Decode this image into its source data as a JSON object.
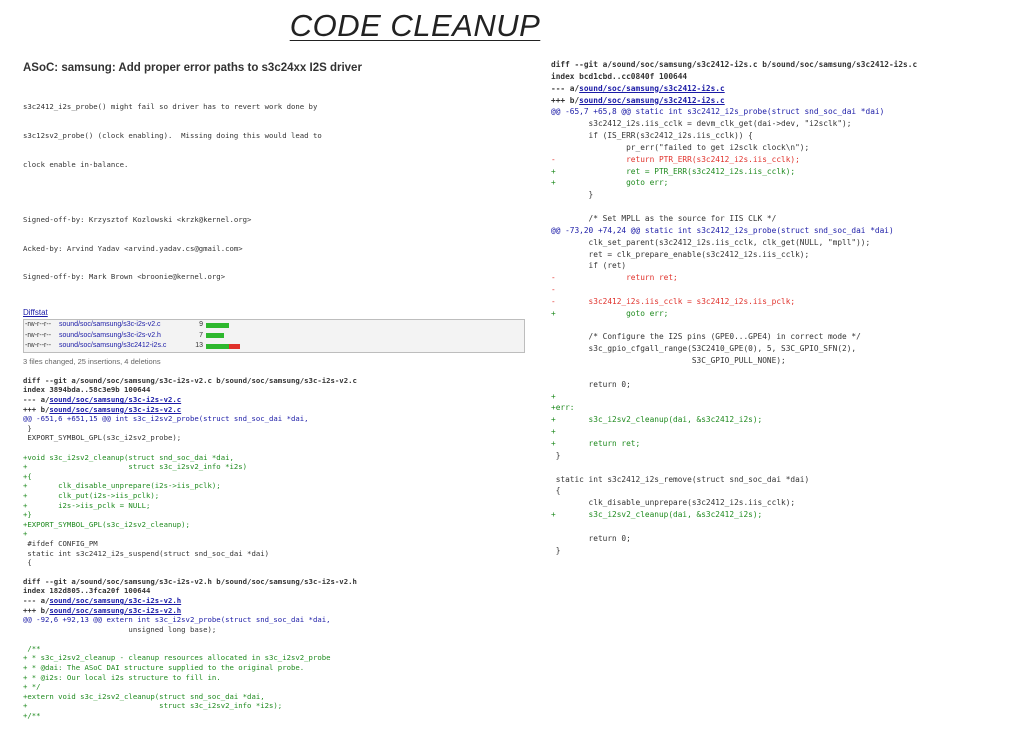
{
  "slide": {
    "title": "CODE CLEANUP"
  },
  "commit": {
    "title": "ASoC: samsung: Add proper error paths to s3c24xx I2S driver",
    "message": [
      "s3c2412_i2s_probe() might fail so driver has to revert work done by",
      "s3c12sv2_probe() (clock enabling).  Missing doing this would lead to",
      "clock enable in-balance."
    ],
    "signoffs": [
      "Signed-off-by: Krzysztof Kozlowski <krzk@kernel.org>",
      "Acked-by: Arvind Yadav <arvind.yadav.cs@gmail.com>",
      "Signed-off-by: Mark Brown <broonie@kernel.org>"
    ]
  },
  "diffstat": {
    "label": "Diffstat",
    "rows": [
      {
        "perm": "-rw-r--r--",
        "path": "sound/soc/samsung/s3c-i2s-v2.c",
        "count": "9",
        "added": 9,
        "removed": 0
      },
      {
        "perm": "-rw-r--r--",
        "path": "sound/soc/samsung/s3c-i2s-v2.h",
        "count": "7",
        "added": 7,
        "removed": 0
      },
      {
        "perm": "-rw-r--r--",
        "path": "sound/soc/samsung/s3c2412-i2s.c",
        "count": "13",
        "added": 9,
        "removed": 4
      }
    ],
    "summary": "3 files changed, 25 insertions, 4 deletions"
  },
  "left_diffs": [
    {
      "header": "diff --git a/sound/soc/samsung/s3c-i2s-v2.c b/sound/soc/samsung/s3c-i2s-v2.c",
      "index": "index 3894bda..58c3e9b 100644",
      "minus_prefix": "--- a/",
      "minus_path": "sound/soc/samsung/s3c-i2s-v2.c",
      "plus_prefix": "+++ b/",
      "plus_path": "sound/soc/samsung/s3c-i2s-v2.c",
      "lines": [
        {
          "t": "hunk",
          "text": "@@ -651,6 +651,15 @@ int s3c_i2sv2_probe(struct snd_soc_dai *dai,"
        },
        {
          "t": "ctx",
          "text": " }"
        },
        {
          "t": "ctx",
          "text": " EXPORT_SYMBOL_GPL(s3c_i2sv2_probe);"
        },
        {
          "t": "ctx",
          "text": " "
        },
        {
          "t": "add",
          "text": "+void s3c_i2sv2_cleanup(struct snd_soc_dai *dai,"
        },
        {
          "t": "add",
          "text": "+                       struct s3c_i2sv2_info *i2s)"
        },
        {
          "t": "add",
          "text": "+{"
        },
        {
          "t": "add",
          "text": "+       clk_disable_unprepare(i2s->iis_pclk);"
        },
        {
          "t": "add",
          "text": "+       clk_put(i2s->iis_pclk);"
        },
        {
          "t": "add",
          "text": "+       i2s->iis_pclk = NULL;"
        },
        {
          "t": "add",
          "text": "+}"
        },
        {
          "t": "add",
          "text": "+EXPORT_SYMBOL_GPL(s3c_i2sv2_cleanup);"
        },
        {
          "t": "add",
          "text": "+"
        },
        {
          "t": "ctx",
          "text": " #ifdef CONFIG_PM"
        },
        {
          "t": "ctx",
          "text": " static int s3c2412_i2s_suspend(struct snd_soc_dai *dai)"
        },
        {
          "t": "ctx",
          "text": " {"
        }
      ]
    },
    {
      "header": "diff --git a/sound/soc/samsung/s3c-i2s-v2.h b/sound/soc/samsung/s3c-i2s-v2.h",
      "index": "index 182d805..3fca20f 100644",
      "minus_prefix": "--- a/",
      "minus_path": "sound/soc/samsung/s3c-i2s-v2.h",
      "plus_prefix": "+++ b/",
      "plus_path": "sound/soc/samsung/s3c-i2s-v2.h",
      "lines": [
        {
          "t": "hunk",
          "text": "@@ -92,6 +92,13 @@ extern int s3c_i2sv2_probe(struct snd_soc_dai *dai,"
        },
        {
          "t": "ctx",
          "text": "                        unsigned long base);"
        },
        {
          "t": "ctx",
          "text": " "
        },
        {
          "t": "add",
          "text": " /**"
        },
        {
          "t": "add",
          "text": "+ * s3c_i2sv2_cleanup - cleanup resources allocated in s3c_i2sv2_probe"
        },
        {
          "t": "add",
          "text": "+ * @dai: The ASoC DAI structure supplied to the original probe."
        },
        {
          "t": "add",
          "text": "+ * @i2s: Our local i2s structure to fill in."
        },
        {
          "t": "add",
          "text": "+ */"
        },
        {
          "t": "add",
          "text": "+extern void s3c_i2sv2_cleanup(struct snd_soc_dai *dai,"
        },
        {
          "t": "add",
          "text": "+                              struct s3c_i2sv2_info *i2s);"
        },
        {
          "t": "add",
          "text": "+/**"
        }
      ]
    }
  ],
  "right_diff": {
    "header": "diff --git a/sound/soc/samsung/s3c2412-i2s.c b/sound/soc/samsung/s3c2412-i2s.c",
    "index": "index bcd1cbd..cc0840f 100644",
    "minus_prefix": "--- a/",
    "minus_path": "sound/soc/samsung/s3c2412-i2s.c",
    "plus_prefix": "+++ b/",
    "plus_path": "sound/soc/samsung/s3c2412-i2s.c",
    "lines": [
      {
        "t": "hunk",
        "text": "@@ -65,7 +65,8 @@ static int s3c2412_i2s_probe(struct snd_soc_dai *dai)"
      },
      {
        "t": "ctx",
        "text": "        s3c2412_i2s.iis_cclk = devm_clk_get(dai->dev, \"i2sclk\");"
      },
      {
        "t": "ctx",
        "text": "        if (IS_ERR(s3c2412_i2s.iis_cclk)) {"
      },
      {
        "t": "ctx",
        "text": "                pr_err(\"failed to get i2sclk clock\\n\");"
      },
      {
        "t": "del",
        "text": "-               return PTR_ERR(s3c2412_i2s.iis_cclk);"
      },
      {
        "t": "add",
        "text": "+               ret = PTR_ERR(s3c2412_i2s.iis_cclk);"
      },
      {
        "t": "add",
        "text": "+               goto err;"
      },
      {
        "t": "ctx",
        "text": "        }"
      },
      {
        "t": "ctx",
        "text": " "
      },
      {
        "t": "ctx",
        "text": "        /* Set MPLL as the source for IIS CLK */"
      },
      {
        "t": "hunk",
        "text": "@@ -73,20 +74,24 @@ static int s3c2412_i2s_probe(struct snd_soc_dai *dai)"
      },
      {
        "t": "ctx",
        "text": "        clk_set_parent(s3c2412_i2s.iis_cclk, clk_get(NULL, \"mpll\"));"
      },
      {
        "t": "ctx",
        "text": "        ret = clk_prepare_enable(s3c2412_i2s.iis_cclk);"
      },
      {
        "t": "ctx",
        "text": "        if (ret)"
      },
      {
        "t": "del",
        "text": "-               return ret;"
      },
      {
        "t": "del",
        "text": "-"
      },
      {
        "t": "del",
        "text": "-       s3c2412_i2s.iis_cclk = s3c2412_i2s.iis_pclk;"
      },
      {
        "t": "add",
        "text": "+               goto err;"
      },
      {
        "t": "ctx",
        "text": " "
      },
      {
        "t": "ctx",
        "text": "        /* Configure the I2S pins (GPE0...GPE4) in correct mode */"
      },
      {
        "t": "ctx",
        "text": "        s3c_gpio_cfgall_range(S3C2410_GPE(0), 5, S3C_GPIO_SFN(2),"
      },
      {
        "t": "ctx",
        "text": "                              S3C_GPIO_PULL_NONE);"
      },
      {
        "t": "ctx",
        "text": " "
      },
      {
        "t": "ctx",
        "text": "        return 0;"
      },
      {
        "t": "add",
        "text": "+"
      },
      {
        "t": "add",
        "text": "+err:"
      },
      {
        "t": "add",
        "text": "+       s3c_i2sv2_cleanup(dai, &s3c2412_i2s);"
      },
      {
        "t": "add",
        "text": "+"
      },
      {
        "t": "add",
        "text": "+       return ret;"
      },
      {
        "t": "ctx",
        "text": " }"
      },
      {
        "t": "ctx",
        "text": " "
      },
      {
        "t": "ctx",
        "text": " static int s3c2412_i2s_remove(struct snd_soc_dai *dai)"
      },
      {
        "t": "ctx",
        "text": " {"
      },
      {
        "t": "ctx",
        "text": "        clk_disable_unprepare(s3c2412_i2s.iis_cclk);"
      },
      {
        "t": "add",
        "text": "+       s3c_i2sv2_cleanup(dai, &s3c2412_i2s);"
      },
      {
        "t": "ctx",
        "text": " "
      },
      {
        "t": "ctx",
        "text": "        return 0;"
      },
      {
        "t": "ctx",
        "text": " }"
      }
    ]
  },
  "colors": {
    "added": "#1e8a1e",
    "removed": "#e0312b",
    "link": "#1a1aa6",
    "text": "#333333"
  }
}
